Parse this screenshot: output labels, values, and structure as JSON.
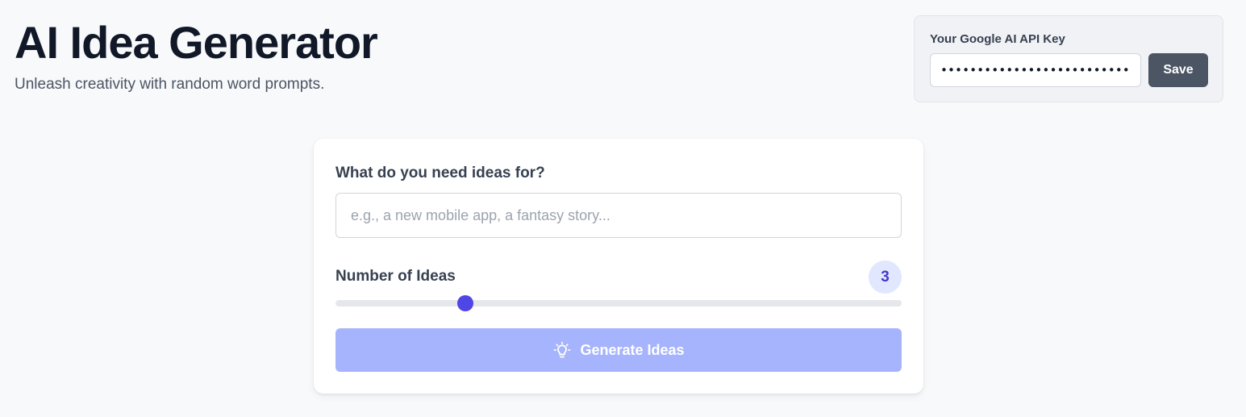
{
  "header": {
    "title": "AI Idea Generator",
    "subtitle": "Unleash creativity with random word prompts."
  },
  "api_key": {
    "label": "Your Google AI API Key",
    "value": "••••••••••••••••••••••••••••",
    "save_label": "Save"
  },
  "form": {
    "prompt_label": "What do you need ideas for?",
    "prompt_placeholder": "e.g., a new mobile app, a fantasy story...",
    "prompt_value": "",
    "count_label": "Number of Ideas",
    "count_value": "3",
    "slider_fraction": 0.23,
    "generate_label": "Generate Ideas",
    "generate_icon": "lightbulb-icon"
  },
  "colors": {
    "accent": "#4f46e5",
    "badge_bg": "#e0e7ff",
    "generate_disabled": "#a5b4fc",
    "save_bg": "#4b5563"
  }
}
